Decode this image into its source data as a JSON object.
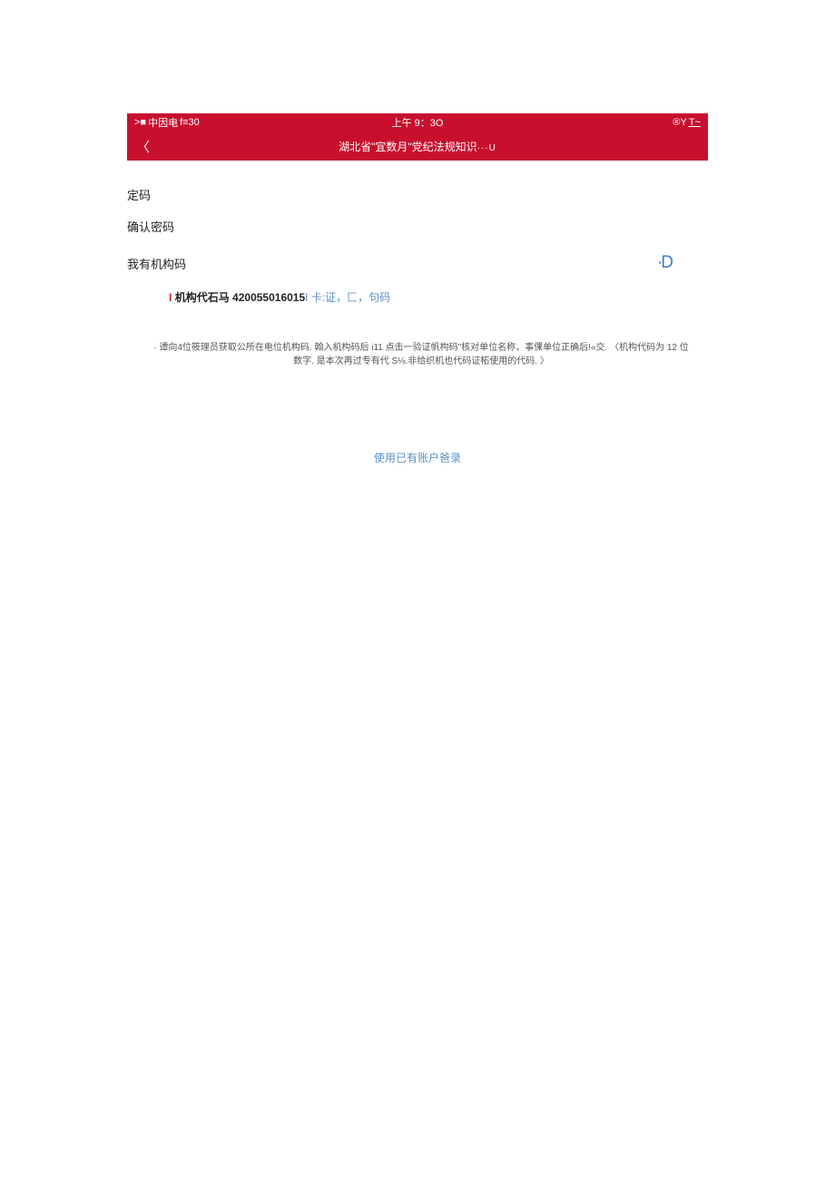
{
  "statusBar": {
    "carrier": "中因电",
    "signal": "f≡30",
    "time": "上午 9：3O",
    "batteryPrefix": "®Y",
    "batterySuffix": "T~"
  },
  "navBar": {
    "backChevron": "〈",
    "title": "湖北省\"宜数月\"党纪法规知识",
    "titleSuffix": "···U"
  },
  "form": {
    "passwordLabel": "定码",
    "confirmPasswordLabel": "确认密码",
    "orgCodeToggleLabel": "我有机构码",
    "toggleIcon": "·D",
    "orgCodePrefix": "I",
    "orgCodeLabel": "机构代石马",
    "orgCodeValue": "420055016015",
    "orgCodeLinkPrefix": "I",
    "orgCodeLinkText": "卡:证，匚，句码"
  },
  "helpText": "· 谭向4位筱理员获取公所在电位机构码. 翰入机构码后 i11 点击一验证帆构码\"核对单位名称，事倮单位正确后!«交. 〈机构代码为 12 位数字. 是本次再过专有代 S⅛.非给织机也代码证柘使用的代码. 〉",
  "loginLink": "使用已有账户爸录"
}
